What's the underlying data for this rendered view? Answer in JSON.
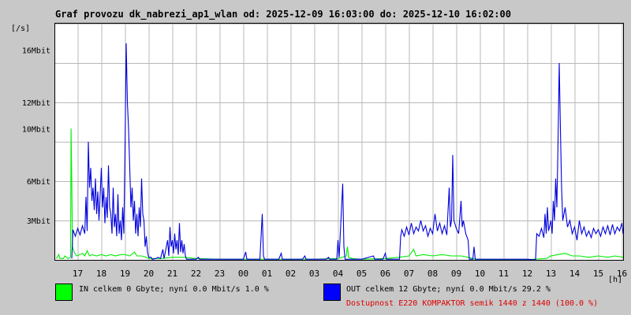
{
  "chart_data": {
    "type": "line",
    "title": "Graf provozu dk_nabrezi_ap1_wlan od: 2025-12-09 16:03:00 do: 2025-12-10 16:02:00",
    "ylabel": "[/s]",
    "xlabel": "[h]",
    "xlim": [
      16.05,
      40.05
    ],
    "ylim": [
      0,
      18
    ],
    "grid": true,
    "x_ticks": [
      {
        "v": 17,
        "label": "17"
      },
      {
        "v": 18,
        "label": "18"
      },
      {
        "v": 19,
        "label": "19"
      },
      {
        "v": 20,
        "label": "20"
      },
      {
        "v": 21,
        "label": "21"
      },
      {
        "v": 22,
        "label": "22"
      },
      {
        "v": 23,
        "label": "23"
      },
      {
        "v": 24,
        "label": "00"
      },
      {
        "v": 25,
        "label": "01"
      },
      {
        "v": 26,
        "label": "02"
      },
      {
        "v": 27,
        "label": "03"
      },
      {
        "v": 28,
        "label": "04"
      },
      {
        "v": 29,
        "label": "05"
      },
      {
        "v": 30,
        "label": "06"
      },
      {
        "v": 31,
        "label": "07"
      },
      {
        "v": 32,
        "label": "08"
      },
      {
        "v": 33,
        "label": "09"
      },
      {
        "v": 34,
        "label": "10"
      },
      {
        "v": 35,
        "label": "11"
      },
      {
        "v": 36,
        "label": "12"
      },
      {
        "v": 37,
        "label": "13"
      },
      {
        "v": 38,
        "label": "14"
      },
      {
        "v": 39,
        "label": "15"
      },
      {
        "v": 40,
        "label": "16"
      }
    ],
    "y_ticks": [
      {
        "v": 3,
        "label": "3Mbit"
      },
      {
        "v": 6,
        "label": "6Mbit"
      },
      {
        "v": 10,
        "label": "10Mbit"
      },
      {
        "v": 12,
        "label": "12Mbit"
      },
      {
        "v": 16,
        "label": "16Mbit"
      }
    ],
    "y_grid": [
      3,
      6,
      9,
      12,
      15,
      18
    ],
    "series": [
      {
        "name": "IN",
        "color": "#00ee00",
        "points": [
          [
            16.1,
            0.1
          ],
          [
            16.2,
            0.4
          ],
          [
            16.25,
            0.1
          ],
          [
            16.4,
            0.1
          ],
          [
            16.45,
            0.3
          ],
          [
            16.6,
            0.1
          ],
          [
            16.7,
            0.2
          ],
          [
            16.72,
            10.0
          ],
          [
            16.75,
            6.0
          ],
          [
            16.78,
            1.0
          ],
          [
            16.85,
            0.6
          ],
          [
            16.95,
            0.3
          ],
          [
            17.1,
            0.4
          ],
          [
            17.2,
            0.5
          ],
          [
            17.3,
            0.3
          ],
          [
            17.4,
            0.7
          ],
          [
            17.5,
            0.3
          ],
          [
            17.6,
            0.4
          ],
          [
            17.8,
            0.3
          ],
          [
            18.0,
            0.4
          ],
          [
            18.2,
            0.3
          ],
          [
            18.4,
            0.4
          ],
          [
            18.6,
            0.3
          ],
          [
            18.8,
            0.4
          ],
          [
            19.0,
            0.4
          ],
          [
            19.2,
            0.3
          ],
          [
            19.4,
            0.6
          ],
          [
            19.5,
            0.3
          ],
          [
            19.7,
            0.3
          ],
          [
            19.9,
            0.2
          ],
          [
            20.0,
            0.1
          ],
          [
            20.5,
            0.1
          ],
          [
            21.0,
            0.2
          ],
          [
            21.5,
            0.2
          ],
          [
            22.0,
            0.1
          ],
          [
            23.0,
            0.05
          ],
          [
            25.0,
            0.05
          ],
          [
            27.0,
            0.05
          ],
          [
            28.0,
            0.1
          ],
          [
            28.35,
            0.3
          ],
          [
            28.4,
            1.0
          ],
          [
            28.45,
            0.2
          ],
          [
            28.6,
            0.1
          ],
          [
            29.0,
            0.05
          ],
          [
            30.0,
            0.1
          ],
          [
            30.6,
            0.2
          ],
          [
            31.0,
            0.3
          ],
          [
            31.2,
            0.8
          ],
          [
            31.3,
            0.3
          ],
          [
            31.6,
            0.4
          ],
          [
            32.0,
            0.3
          ],
          [
            32.4,
            0.4
          ],
          [
            32.8,
            0.3
          ],
          [
            33.2,
            0.3
          ],
          [
            33.5,
            0.2
          ],
          [
            33.8,
            0.05
          ],
          [
            34.5,
            0.02
          ],
          [
            36.0,
            0.02
          ],
          [
            36.8,
            0.1
          ],
          [
            37.0,
            0.3
          ],
          [
            37.3,
            0.4
          ],
          [
            37.6,
            0.5
          ],
          [
            37.9,
            0.3
          ],
          [
            38.2,
            0.3
          ],
          [
            38.6,
            0.2
          ],
          [
            39.0,
            0.3
          ],
          [
            39.4,
            0.2
          ],
          [
            39.7,
            0.3
          ],
          [
            40.05,
            0.2
          ]
        ]
      },
      {
        "name": "OUT",
        "color": "#0000dd",
        "points": [
          [
            16.75,
            0.1
          ],
          [
            16.8,
            2.3
          ],
          [
            16.9,
            1.8
          ],
          [
            17.0,
            2.4
          ],
          [
            17.1,
            1.9
          ],
          [
            17.2,
            2.6
          ],
          [
            17.3,
            2.0
          ],
          [
            17.35,
            4.8
          ],
          [
            17.4,
            2.2
          ],
          [
            17.45,
            9.0
          ],
          [
            17.5,
            5.5
          ],
          [
            17.55,
            7.0
          ],
          [
            17.6,
            4.5
          ],
          [
            17.65,
            5.5
          ],
          [
            17.7,
            3.8
          ],
          [
            17.75,
            6.2
          ],
          [
            17.8,
            3.5
          ],
          [
            17.85,
            5.2
          ],
          [
            17.9,
            3.0
          ],
          [
            18.0,
            7.0
          ],
          [
            18.05,
            4.0
          ],
          [
            18.1,
            5.5
          ],
          [
            18.15,
            2.8
          ],
          [
            18.2,
            4.8
          ],
          [
            18.25,
            3.2
          ],
          [
            18.3,
            7.2
          ],
          [
            18.35,
            4.0
          ],
          [
            18.4,
            3.5
          ],
          [
            18.45,
            2.0
          ],
          [
            18.5,
            5.5
          ],
          [
            18.55,
            2.5
          ],
          [
            18.6,
            3.5
          ],
          [
            18.65,
            1.8
          ],
          [
            18.7,
            5.0
          ],
          [
            18.75,
            2.0
          ],
          [
            18.8,
            3.0
          ],
          [
            18.85,
            1.5
          ],
          [
            18.9,
            4.0
          ],
          [
            18.95,
            2.0
          ],
          [
            19.0,
            8.5
          ],
          [
            19.05,
            16.5
          ],
          [
            19.1,
            12.0
          ],
          [
            19.15,
            10.0
          ],
          [
            19.2,
            7.0
          ],
          [
            19.25,
            4.0
          ],
          [
            19.3,
            5.5
          ],
          [
            19.35,
            3.0
          ],
          [
            19.4,
            4.5
          ],
          [
            19.45,
            2.0
          ],
          [
            19.5,
            3.5
          ],
          [
            19.55,
            1.8
          ],
          [
            19.6,
            4.0
          ],
          [
            19.65,
            2.5
          ],
          [
            19.7,
            6.2
          ],
          [
            19.75,
            3.5
          ],
          [
            19.8,
            3.0
          ],
          [
            19.85,
            1.0
          ],
          [
            19.9,
            1.8
          ],
          [
            19.95,
            0.6
          ],
          [
            20.0,
            0.2
          ],
          [
            20.1,
            0.2
          ],
          [
            20.15,
            0.05
          ],
          [
            20.3,
            0.1
          ],
          [
            20.4,
            0.2
          ],
          [
            20.5,
            0.1
          ],
          [
            20.6,
            0.8
          ],
          [
            20.65,
            0.1
          ],
          [
            20.8,
            1.5
          ],
          [
            20.85,
            0.3
          ],
          [
            20.9,
            2.5
          ],
          [
            20.95,
            1.0
          ],
          [
            21.0,
            1.5
          ],
          [
            21.05,
            0.5
          ],
          [
            21.1,
            2.0
          ],
          [
            21.15,
            0.8
          ],
          [
            21.2,
            1.5
          ],
          [
            21.25,
            0.4
          ],
          [
            21.3,
            2.8
          ],
          [
            21.35,
            0.6
          ],
          [
            21.4,
            1.5
          ],
          [
            21.45,
            0.5
          ],
          [
            21.5,
            1.2
          ],
          [
            21.55,
            0.3
          ],
          [
            21.6,
            0.05
          ],
          [
            22.0,
            0.05
          ],
          [
            22.1,
            0.2
          ],
          [
            22.15,
            0.05
          ],
          [
            23.0,
            0.05
          ],
          [
            24.0,
            0.05
          ],
          [
            24.1,
            0.6
          ],
          [
            24.15,
            0.05
          ],
          [
            24.7,
            0.05
          ],
          [
            24.8,
            3.5
          ],
          [
            24.85,
            0.3
          ],
          [
            24.9,
            0.05
          ],
          [
            25.5,
            0.05
          ],
          [
            25.6,
            0.5
          ],
          [
            25.65,
            0.05
          ],
          [
            26.5,
            0.05
          ],
          [
            26.6,
            0.3
          ],
          [
            26.65,
            0.05
          ],
          [
            27.5,
            0.05
          ],
          [
            27.6,
            0.2
          ],
          [
            27.65,
            0.05
          ],
          [
            27.95,
            0.05
          ],
          [
            28.0,
            1.5
          ],
          [
            28.05,
            0.2
          ],
          [
            28.2,
            5.8
          ],
          [
            28.25,
            1.0
          ],
          [
            28.3,
            0.05
          ],
          [
            29.0,
            0.05
          ],
          [
            29.5,
            0.3
          ],
          [
            29.55,
            0.05
          ],
          [
            29.9,
            0.05
          ],
          [
            30.0,
            0.5
          ],
          [
            30.05,
            0.05
          ],
          [
            30.6,
            0.05
          ],
          [
            30.65,
            1.8
          ],
          [
            30.7,
            2.3
          ],
          [
            30.8,
            1.8
          ],
          [
            30.9,
            2.5
          ],
          [
            31.0,
            1.9
          ],
          [
            31.1,
            2.8
          ],
          [
            31.2,
            2.0
          ],
          [
            31.3,
            2.5
          ],
          [
            31.4,
            2.2
          ],
          [
            31.5,
            3.0
          ],
          [
            31.6,
            2.2
          ],
          [
            31.7,
            2.6
          ],
          [
            31.8,
            1.8
          ],
          [
            31.9,
            2.4
          ],
          [
            32.0,
            2.0
          ],
          [
            32.1,
            3.5
          ],
          [
            32.2,
            2.2
          ],
          [
            32.3,
            2.8
          ],
          [
            32.4,
            2.0
          ],
          [
            32.5,
            2.6
          ],
          [
            32.6,
            1.9
          ],
          [
            32.7,
            5.5
          ],
          [
            32.75,
            2.5
          ],
          [
            32.8,
            3.0
          ],
          [
            32.85,
            8.0
          ],
          [
            32.9,
            3.0
          ],
          [
            33.0,
            2.4
          ],
          [
            33.1,
            2.0
          ],
          [
            33.2,
            4.5
          ],
          [
            33.25,
            2.5
          ],
          [
            33.3,
            3.0
          ],
          [
            33.4,
            2.0
          ],
          [
            33.5,
            1.5
          ],
          [
            33.55,
            0.05
          ],
          [
            33.7,
            0.05
          ],
          [
            33.75,
            1.0
          ],
          [
            33.8,
            0.05
          ],
          [
            36.0,
            0.05
          ],
          [
            36.2,
            0.02
          ],
          [
            36.35,
            0.02
          ],
          [
            36.4,
            2.0
          ],
          [
            36.5,
            1.8
          ],
          [
            36.6,
            2.4
          ],
          [
            36.7,
            1.7
          ],
          [
            36.75,
            3.5
          ],
          [
            36.8,
            2.0
          ],
          [
            36.85,
            4.0
          ],
          [
            36.9,
            2.2
          ],
          [
            37.0,
            3.0
          ],
          [
            37.05,
            2.0
          ],
          [
            37.1,
            4.5
          ],
          [
            37.15,
            3.0
          ],
          [
            37.2,
            6.2
          ],
          [
            37.25,
            4.0
          ],
          [
            37.3,
            9.0
          ],
          [
            37.35,
            15.0
          ],
          [
            37.4,
            10.0
          ],
          [
            37.45,
            5.5
          ],
          [
            37.5,
            3.0
          ],
          [
            37.6,
            4.0
          ],
          [
            37.7,
            2.5
          ],
          [
            37.8,
            3.0
          ],
          [
            37.9,
            2.0
          ],
          [
            38.0,
            2.5
          ],
          [
            38.1,
            1.5
          ],
          [
            38.2,
            3.0
          ],
          [
            38.3,
            2.0
          ],
          [
            38.4,
            2.5
          ],
          [
            38.5,
            1.8
          ],
          [
            38.6,
            2.2
          ],
          [
            38.7,
            1.7
          ],
          [
            38.8,
            2.4
          ],
          [
            38.9,
            2.0
          ],
          [
            39.0,
            2.3
          ],
          [
            39.1,
            1.8
          ],
          [
            39.2,
            2.5
          ],
          [
            39.3,
            2.0
          ],
          [
            39.4,
            2.6
          ],
          [
            39.5,
            1.9
          ],
          [
            39.6,
            2.7
          ],
          [
            39.7,
            2.0
          ],
          [
            39.8,
            2.5
          ],
          [
            39.9,
            2.2
          ],
          [
            40.0,
            2.8
          ],
          [
            40.05,
            2.0
          ]
        ]
      }
    ]
  },
  "legend": {
    "in_color": "#00ff00",
    "out_color": "#0000ff",
    "in_text": "IN celkem 0 Gbyte; nyní   0.0 Mbit/s 1.0 %",
    "out_text": "OUT celkem 12 Gbyte; nyní   0.0 Mbit/s 29.2 %",
    "availability_text": "Dostupnost E220 KOMPAKTOR semik 1440 z 1440 (100.0 %)"
  }
}
